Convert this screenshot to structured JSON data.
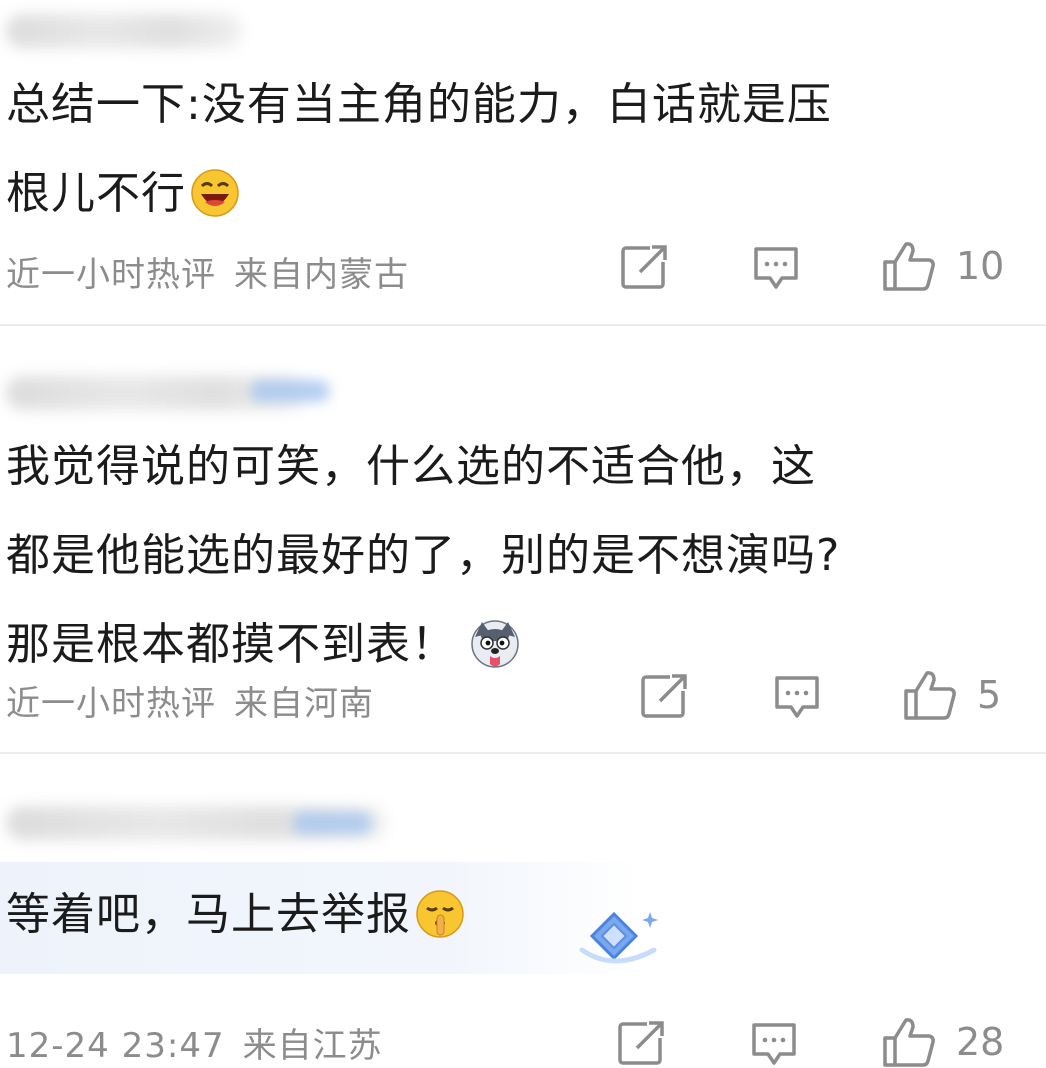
{
  "comments": [
    {
      "text_line1": "总结一下:没有当主角的能力，白话就是压",
      "text_line2": "根儿不行",
      "emoji": "laughing-face-icon",
      "time": "近一小时热评",
      "location": "来自内蒙古",
      "likes": "10"
    },
    {
      "text_line1": "我觉得说的可笑，什么选的不适合他，这",
      "text_line2": "都是他能选的最好的了，别的是不想演吗?",
      "text_line3": "那是根本都摸不到表！",
      "emoji": "husky-dog-icon",
      "time": "近一小时热评",
      "location": "来自河南",
      "likes": "5"
    },
    {
      "text_line1": "等着吧，马上去举报",
      "emoji": "shushing-face-icon",
      "time": "12-24 23:47",
      "location": "来自江苏",
      "likes": "28"
    }
  ],
  "colors": {
    "text": "#1b1b1b",
    "meta": "#8c8c8c",
    "divider": "#ececec",
    "highlight": "#eef3fb",
    "badge": "#a9c7ef"
  }
}
